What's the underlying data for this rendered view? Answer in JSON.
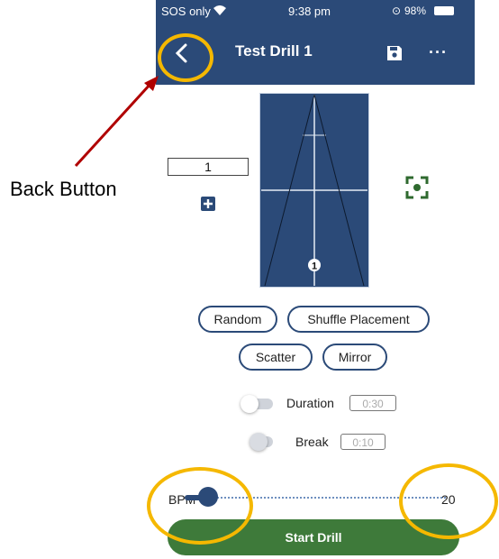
{
  "status_bar": {
    "carrier": "SOS only",
    "time": "9:38 pm",
    "battery": "98%"
  },
  "app_bar": {
    "title": "Test Drill 1"
  },
  "ball_counter": {
    "value": "1"
  },
  "table": {
    "ball_marker": "1"
  },
  "placement_buttons": [
    "Random",
    "Shuffle Placement",
    "Scatter",
    "Mirror"
  ],
  "duration": {
    "label": "Duration",
    "value": "0:30"
  },
  "break": {
    "label": "Break",
    "value": "0:10"
  },
  "bpm": {
    "label": "BPM",
    "value": "20"
  },
  "start_button": {
    "label": "Start Drill"
  },
  "annotation": {
    "caption": "Back Button"
  },
  "colors": {
    "primary": "#2b4a78",
    "start": "#3e7a3a",
    "highlight": "#f5b800",
    "arrow": "#b00000"
  }
}
